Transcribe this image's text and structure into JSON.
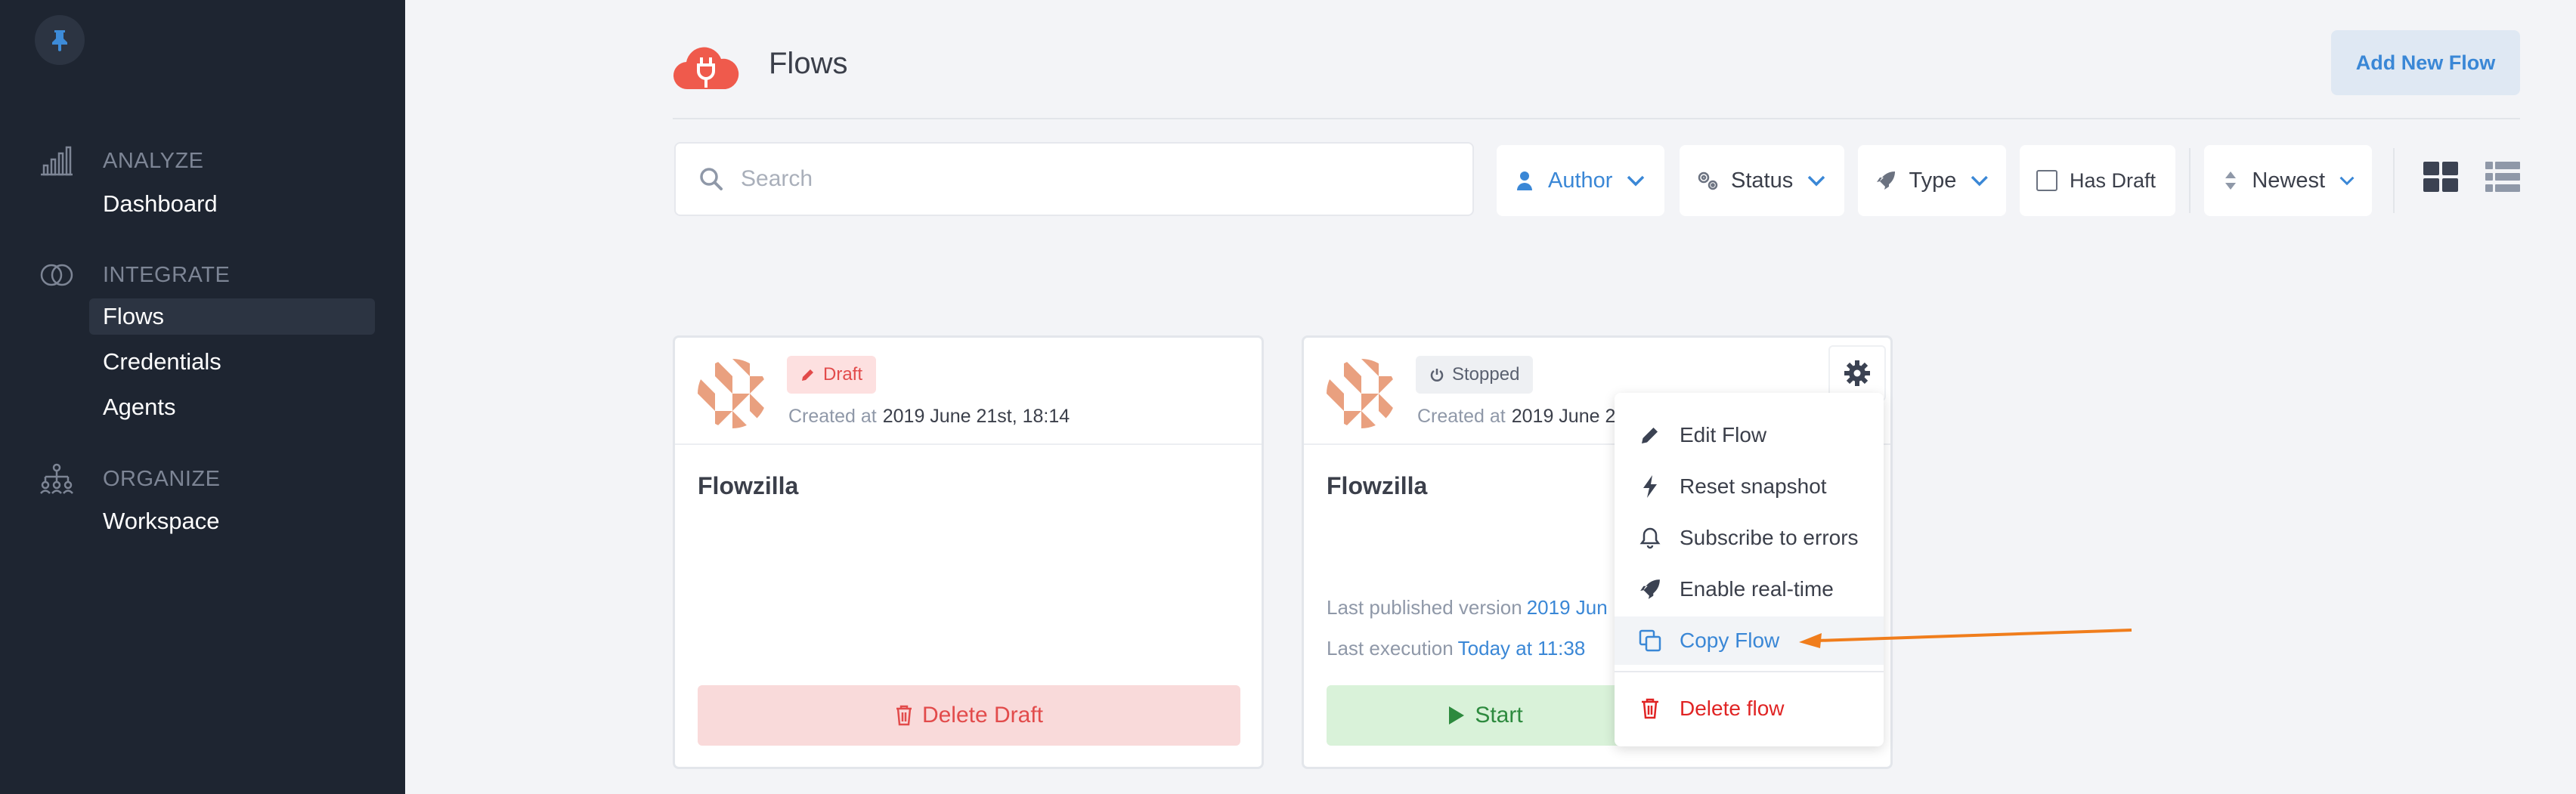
{
  "sidebar": {
    "sections": [
      {
        "label": "ANALYZE",
        "icon": "bar-chart-icon",
        "items": [
          {
            "label": "Dashboard"
          }
        ]
      },
      {
        "label": "INTEGRATE",
        "icon": "integrate-rings-icon",
        "items": [
          {
            "label": "Flows"
          },
          {
            "label": "Credentials"
          },
          {
            "label": "Agents"
          }
        ]
      },
      {
        "label": "ORGANIZE",
        "icon": "org-chart-icon",
        "items": [
          {
            "label": "Workspace"
          }
        ]
      }
    ]
  },
  "header": {
    "title": "Flows",
    "add_button": "Add New Flow"
  },
  "filters": {
    "search_placeholder": "Search",
    "author": "Author",
    "status": "Status",
    "type": "Type",
    "has_draft": "Has Draft",
    "sort": "Newest"
  },
  "cards": [
    {
      "badge": "Draft",
      "created_label": "Created at",
      "created_value": "2019 June 21st, 18:14",
      "title": "Flowzilla",
      "action": "Delete Draft"
    },
    {
      "badge": "Stopped",
      "created_label": "Created at",
      "created_value": "2019 June 21",
      "title": "Flowzilla",
      "published_label": "Last published version",
      "published_value": "2019 Jun",
      "execution_label": "Last execution",
      "execution_value": "Today at 11:38",
      "action": "Start"
    }
  ],
  "menu": {
    "items": [
      {
        "label": "Edit Flow",
        "icon": "pencil-icon"
      },
      {
        "label": "Reset snapshot",
        "icon": "bolt-icon"
      },
      {
        "label": "Subscribe to errors",
        "icon": "bell-icon"
      },
      {
        "label": "Enable real-time",
        "icon": "rocket-icon"
      },
      {
        "label": "Copy Flow",
        "icon": "copy-icon"
      },
      {
        "label": "Delete flow",
        "icon": "trash-icon"
      }
    ]
  },
  "colors": {
    "sidebar_bg": "#1e2531",
    "accent": "#3a87d6",
    "danger": "#e02424",
    "arrow": "#f07d1c"
  }
}
